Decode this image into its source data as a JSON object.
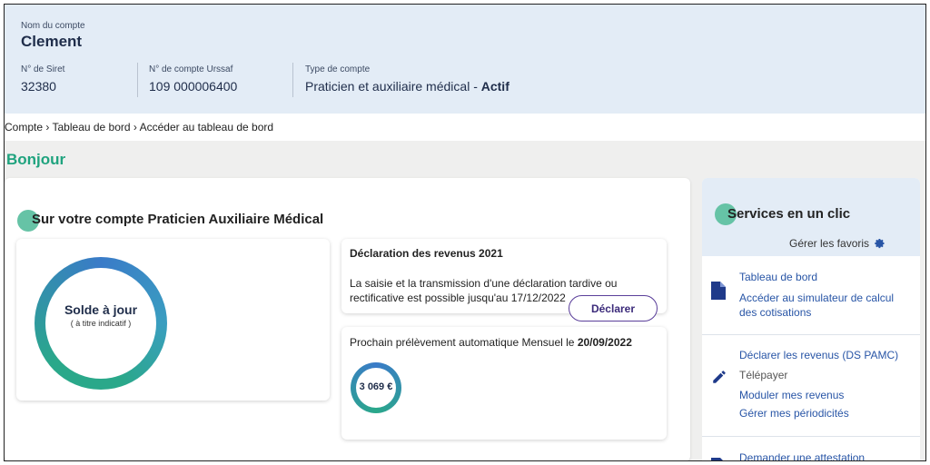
{
  "account": {
    "name_label": "Nom du compte",
    "name": "Clement",
    "siret_label": "N° de Siret",
    "siret_value": "32380",
    "urssaf_label": "N° de compte Urssaf",
    "urssaf_value": "109 000006400",
    "type_label": "Type de compte",
    "type_value": "Praticien et auxiliaire médical - ",
    "type_status": "Actif"
  },
  "breadcrumb": {
    "item1": "Compte",
    "item2": "Tableau de bord",
    "item3": "Accéder au tableau de bord",
    "separator": "›"
  },
  "greeting": "Bonjour",
  "main": {
    "title": "Sur votre compte Praticien Auxiliaire Médical",
    "balance": {
      "title": "Solde à jour",
      "subtitle": "( à titre indicatif )"
    },
    "declaration": {
      "title": "Déclaration des revenus 2021",
      "text_line1": "La saisie et la transmission d'une déclaration tardive ou",
      "text_line2": "rectificative est possible jusqu'au 17/12/2022",
      "button": "Déclarer"
    },
    "payment": {
      "text": "Prochain prélèvement automatique Mensuel le ",
      "date": "20/09/2022",
      "amount": "3 069 €"
    }
  },
  "services": {
    "title": "Services en un clic",
    "favorites": "Gérer les favoris",
    "group1": {
      "link1": "Tableau de bord",
      "link2_line1": "Accéder au simulateur de calcul",
      "link2_line2": "des cotisations"
    },
    "group2": {
      "link1": "Déclarer les revenus (DS PAMC)",
      "text2": "Télépayer",
      "link3": "Moduler mes revenus",
      "link4": "Gérer mes périodicités"
    },
    "group3": {
      "link1": "Demander une attestation"
    }
  },
  "colors": {
    "accent_green": "#1fa37e",
    "link_blue": "#2855a6",
    "button_purple": "#5a3e9a"
  },
  "icons": {
    "doc": "document-icon",
    "pen": "pen-icon",
    "gear": "gear-icon"
  }
}
